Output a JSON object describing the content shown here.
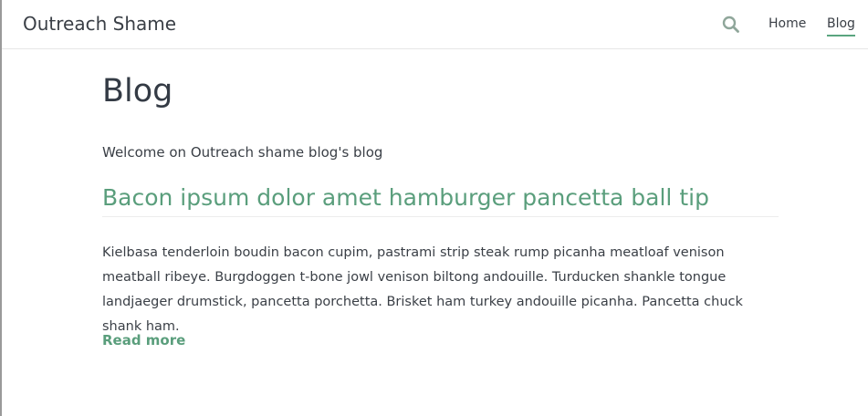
{
  "header": {
    "site_title": "Outreach Shame",
    "search_icon": "search-icon",
    "nav": [
      {
        "label": "Home",
        "active": false
      },
      {
        "label": "Blog",
        "active": true
      }
    ]
  },
  "main": {
    "page_title": "Blog",
    "intro": "Welcome on Outreach shame blog's blog",
    "posts": [
      {
        "title": "Bacon ipsum dolor amet hamburger pancetta ball tip",
        "excerpt": "Kielbasa tenderloin boudin bacon cupim, pastrami strip steak rump picanha meatloaf venison meatball ribeye. Burgdoggen t-bone jowl venison biltong andouille. Turducken shankle tongue landjaeger drumstick, pancetta porchetta. Brisket ham turkey andouille picanha. Pancetta chuck shank ham.",
        "read_more": "Read more"
      }
    ]
  },
  "colors": {
    "accent": "#5a9e7c",
    "text": "#3a3f46",
    "heading": "#343b45"
  }
}
